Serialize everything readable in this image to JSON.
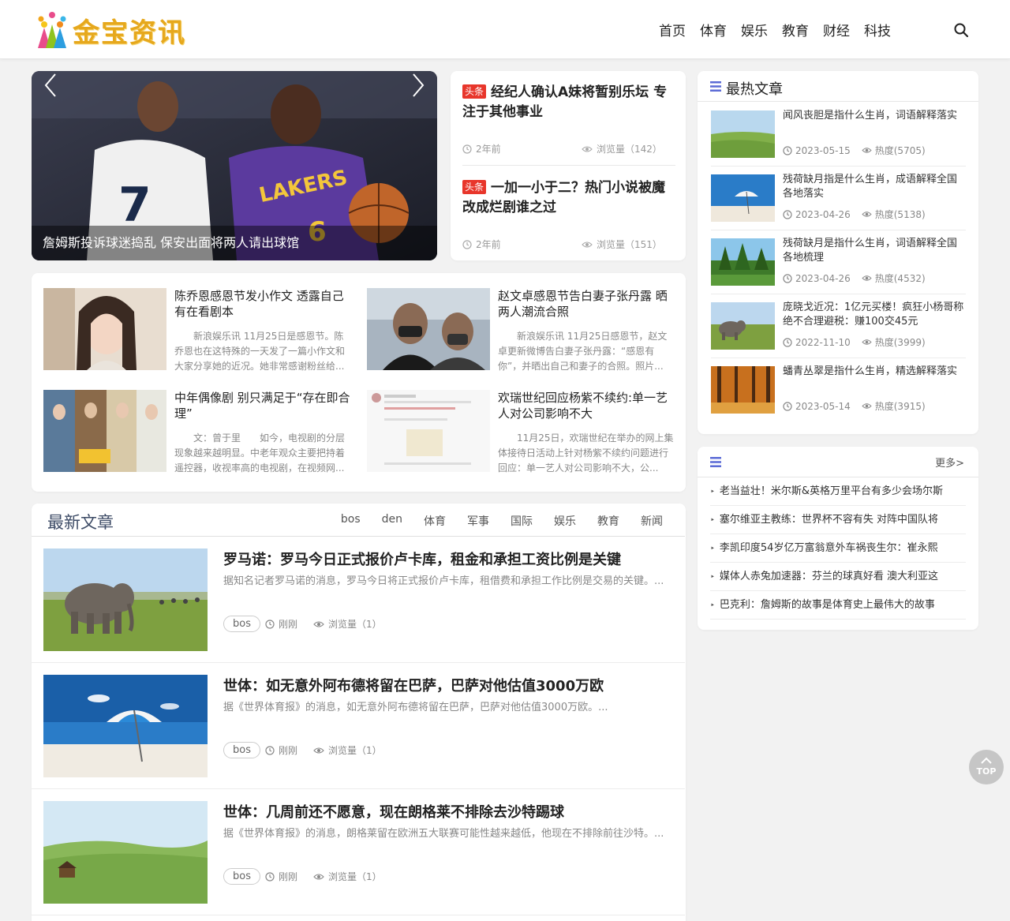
{
  "brand": {
    "logo_text": "金宝资讯"
  },
  "nav": [
    "首页",
    "体育",
    "娱乐",
    "教育",
    "财经",
    "科技"
  ],
  "slider": {
    "caption": "詹姆斯投诉球迷捣乱 保安出面将两人请出球馆"
  },
  "headlines": [
    {
      "badge": "头条",
      "title": "经纪人确认A妹将暂别乐坛 专注于其他事业",
      "time": "2年前",
      "views": "浏览量（142）"
    },
    {
      "badge": "头条",
      "title": "一加一小于二？热门小说被魔改成烂剧谁之过",
      "time": "2年前",
      "views": "浏览量（151）"
    }
  ],
  "grid": [
    {
      "title": "陈乔恩感恩节发小作文 透露自己有在看剧本",
      "desc": "新浪娱乐讯 11月25日是感恩节。陈乔恩也在这特殊的一天发了一篇小作文和大家分享她的近况。她非常感谢粉丝给..."
    },
    {
      "title": "赵文卓感恩节告白妻子张丹露 晒两人潮流合照",
      "desc": "新浪娱乐讯 11月25日感恩节，赵文卓更新微博告白妻子张丹露：“感恩有你”，并晒出自己和妻子的合照。照片..."
    },
    {
      "title": "中年偶像剧 别只满足于“存在即合理”",
      "desc": "文：曾于里　　如今，电视剧的分层现象越来越明显。中老年观众主要把持着遥控器，收视率高的电视剧，在视频网..."
    },
    {
      "title": "欢瑞世纪回应杨紫不续约:单一艺人对公司影响不大",
      "desc": "11月25日，欢瑞世纪在举办的网上集体接待日活动上针对杨紫不续约问题进行回应：单一艺人对公司影响不大，公..."
    }
  ],
  "latest": {
    "title": "最新文章",
    "tabs": [
      "bos",
      "den",
      "体育",
      "军事",
      "国际",
      "娱乐",
      "教育",
      "新闻"
    ],
    "articles": [
      {
        "title": "罗马诺：罗马今日正式报价卢卡库，租金和承担工资比例是关键",
        "desc": "据知名记者罗马诺的消息，罗马今日将正式报价卢卡库，租借费和承担工作比例是交易的关键。...",
        "tag": "bos",
        "time": "刚刚",
        "views": "浏览量（1）"
      },
      {
        "title": "世体：如无意外阿布德将留在巴萨，巴萨对他估值3000万欧",
        "desc": "据《世界体育报》的消息，如无意外阿布德将留在巴萨，巴萨对他估值3000万欧。...",
        "tag": "bos",
        "time": "刚刚",
        "views": "浏览量（1）"
      },
      {
        "title": "世体：几周前还不愿意，现在朗格莱不排除去沙特踢球",
        "desc": "据《世界体育报》的消息，朗格莱留在欧洲五大联赛可能性越来越低，他现在不排除前往沙特。...",
        "tag": "bos",
        "time": "刚刚",
        "views": "浏览量（1）"
      }
    ]
  },
  "hot": {
    "title": "最热文章",
    "items": [
      {
        "title": "闻风丧胆是指什么生肖，词语解释落实",
        "date": "2023-05-15",
        "heat": "热度(5705)"
      },
      {
        "title": "残荷缺月指是什么生肖，成语解释全国各地落实",
        "date": "2023-04-26",
        "heat": "热度(5138)"
      },
      {
        "title": "残荷缺月是指什么生肖，词语解释全国各地梳理",
        "date": "2023-04-26",
        "heat": "热度(4532)"
      },
      {
        "title": "庞晓戈近况：1亿元买楼！疯狂小杨哥称绝不合理避税：赚100交45元",
        "date": "2022-11-10",
        "heat": "热度(3999)"
      },
      {
        "title": "蟠青丛翠是指什么生肖，精选解释落实",
        "date": "2023-05-14",
        "heat": "热度(3915)"
      }
    ]
  },
  "links": {
    "more": "更多>",
    "items": [
      "老当益壮！米尔斯&英格万里平台有多少会场尔斯",
      "塞尔维亚主教练：世界杯不容有失 对阵中国队将",
      "李凯印度54岁亿万富翁意外车祸丧生尔：崔永熙",
      "媒体人赤兔加速器：芬兰的球真好看 澳大利亚这",
      "巴克利：詹姆斯的故事是体育史上最伟大的故事"
    ]
  },
  "top_button": "TOP"
}
